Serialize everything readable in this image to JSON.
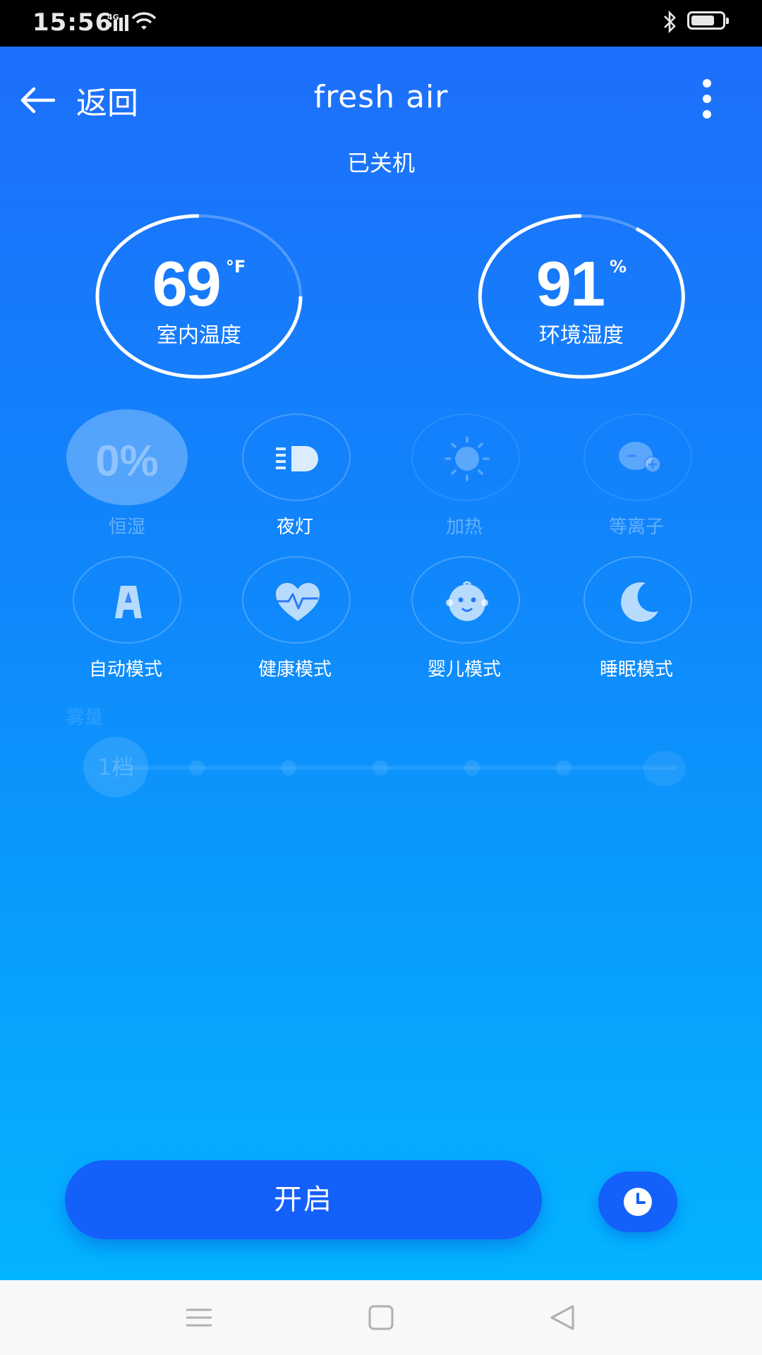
{
  "status_bar": {
    "time": "15:56",
    "network": "4G",
    "battery_level": 0.75
  },
  "header": {
    "back_label": "返回",
    "title": "fresh air"
  },
  "device_status": "已关机",
  "gauges": {
    "temperature": {
      "value": "69",
      "unit": "°F",
      "label": "室内温度"
    },
    "humidity": {
      "value": "91",
      "unit": "%",
      "label": "环境湿度"
    }
  },
  "functions": [
    {
      "label": "恒湿",
      "icon": "percent-icon",
      "enabled": false,
      "display": "0%"
    },
    {
      "label": "夜灯",
      "icon": "night-light-icon",
      "enabled": true
    },
    {
      "label": "加热",
      "icon": "sun-icon",
      "enabled": false
    },
    {
      "label": "等离子",
      "icon": "plasma-icon",
      "enabled": false
    },
    {
      "label": "自动模式",
      "icon": "auto-a-icon",
      "enabled": true
    },
    {
      "label": "健康模式",
      "icon": "heart-pulse-icon",
      "enabled": true
    },
    {
      "label": "婴儿模式",
      "icon": "baby-face-icon",
      "enabled": true
    },
    {
      "label": "睡眠模式",
      "icon": "moon-icon",
      "enabled": true
    }
  ],
  "mist": {
    "label": "雾量",
    "level_label": "1档",
    "level": 1,
    "levels": 7
  },
  "power_button": {
    "label": "开启"
  },
  "timer_button": {
    "icon": "clock-icon"
  },
  "nav_bar": {
    "icons": [
      "menu-icon",
      "home-square-icon",
      "back-triangle-icon"
    ]
  },
  "colors": {
    "primary_blue": "#1460fa",
    "gradient_top": "#1d6ffb",
    "gradient_bottom": "#03b4ff"
  }
}
